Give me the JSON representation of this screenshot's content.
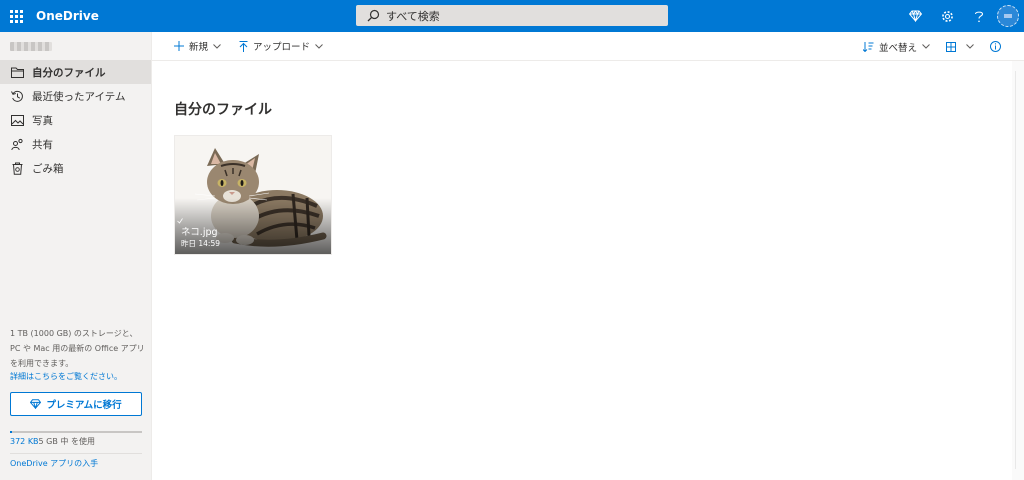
{
  "app": {
    "name": "OneDrive"
  },
  "search": {
    "placeholder": "すべて検索"
  },
  "header_icons": [
    "premium-diamond-icon",
    "settings-gear-icon",
    "help-icon",
    "avatar"
  ],
  "sidebar": {
    "items": [
      {
        "label": "自分のファイル",
        "icon": "folder-icon",
        "active": true
      },
      {
        "label": "最近使ったアイテム",
        "icon": "history-icon",
        "active": false
      },
      {
        "label": "写真",
        "icon": "photo-icon",
        "active": false
      },
      {
        "label": "共有",
        "icon": "share-icon",
        "active": false
      },
      {
        "label": "ごみ箱",
        "icon": "trash-icon",
        "active": false
      }
    ],
    "storage_note": "1 TB (1000 GB) のストレージと、PC や Mac 用の最新の Office アプリを利用できます。",
    "details_link": "詳細はこちらをご覧ください。",
    "premium_button": "プレミアムに移行",
    "usage_amount": "372 KB",
    "usage_rest": "5 GB 中 を使用",
    "usage_fraction": 0.0001,
    "get_app": "OneDrive アプリの入手"
  },
  "commands": {
    "new": "新規",
    "upload": "アップロード",
    "sort": "並べ替え"
  },
  "main": {
    "title": "自分のファイル",
    "files": [
      {
        "name": "ネコ.jpg",
        "modified": "昨日 14:59"
      }
    ]
  },
  "colors": {
    "accent": "#0078d4",
    "sidebar_bg": "#f3f2f1",
    "active_item": "#e1dfdd"
  }
}
